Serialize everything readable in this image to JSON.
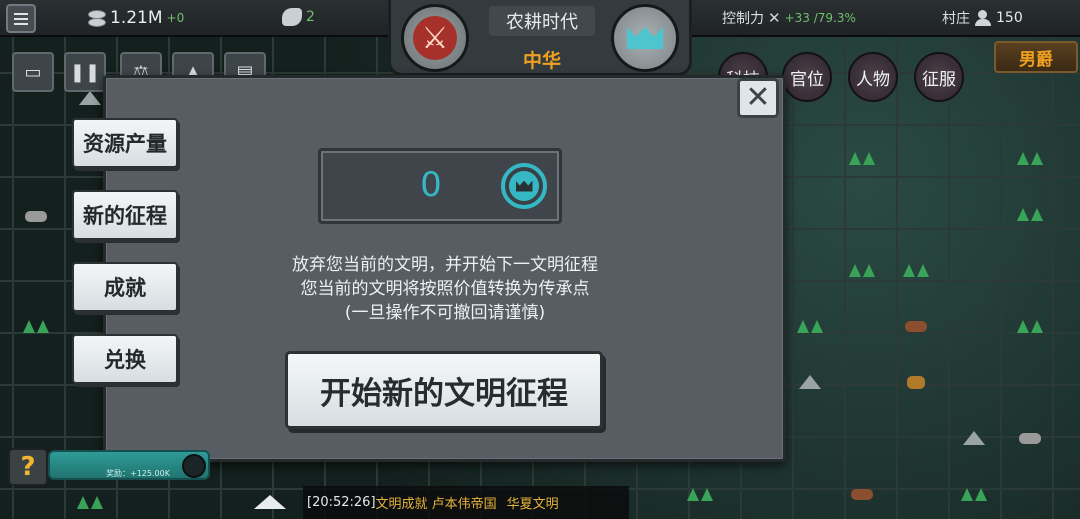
{
  "topbar": {
    "menu_icon": "hamburger-icon",
    "gold": {
      "icon": "coins-icon",
      "value": "1.21M",
      "delta": "+0"
    },
    "strength": {
      "icon": "arm-icon",
      "value": "2"
    },
    "era": "农耕时代",
    "civilization": "中华",
    "control": {
      "label": "控制力",
      "icon": "crossed-swords-icon",
      "value": "+33 /79.3%"
    },
    "village": {
      "label": "村庄",
      "icon": "people-icon",
      "value": "150"
    }
  },
  "right_menu": {
    "item1": "科技",
    "item2": "官位",
    "item3": "人物",
    "item4": "征服",
    "rank": "男爵"
  },
  "dialog": {
    "close_icon": "close-icon",
    "tabs": [
      "资源产量",
      "新的征程",
      "成就",
      "兑换"
    ],
    "points_value": "0",
    "points_icon": "crown-icon",
    "description": [
      "放弃您当前的文明，并开始下一文明征程",
      "您当前的文明将按照价值转换为传承点",
      "(一旦操作不可撤回请谨慎)"
    ],
    "start_button": "开始新的文明征程"
  },
  "bottom": {
    "help": "?",
    "reward_label": "奖励：+125.00K",
    "log_time": "[20:52:26]",
    "log_entries": [
      "文明成就  卢本伟帝国",
      "华夏文明"
    ]
  },
  "colors": {
    "accent_teal": "#35b8c4",
    "civ_orange": "#f0a020",
    "growth_green": "#6fbf6d",
    "war_red": "#a6302a"
  }
}
